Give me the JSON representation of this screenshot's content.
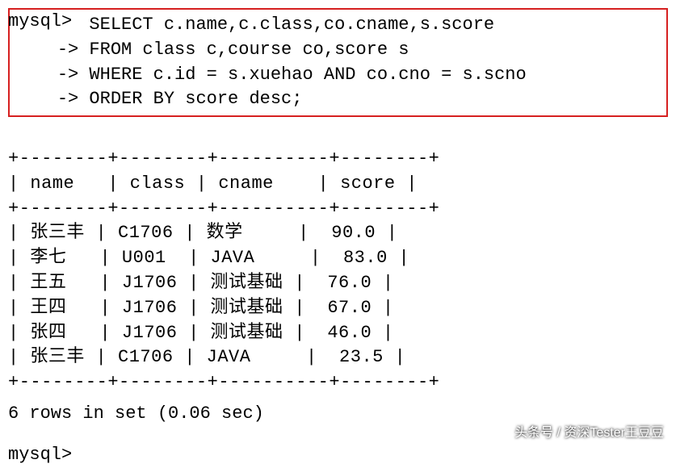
{
  "prompt": "mysql>",
  "continuation": "-> ",
  "query": {
    "line1": "SELECT c.name,c.class,co.cname,s.score",
    "line2": "FROM class c,course co,score s",
    "line3": "WHERE c.id = s.xuehao AND co.cno = s.scno",
    "line4": "ORDER BY score desc;"
  },
  "table": {
    "border_top": "+--------+--------+----------+--------+",
    "header": "| name   | class | cname    | score |",
    "border_mid": "+--------+--------+----------+--------+",
    "rows": [
      "| 张三丰 | C1706 | 数学     |  90.0 |",
      "| 李七   | U001  | JAVA     |  83.0 |",
      "| 王五   | J1706 | 测试基础 |  76.0 |",
      "| 王四   | J1706 | 测试基础 |  67.0 |",
      "| 张四   | J1706 | 测试基础 |  46.0 |",
      "| 张三丰 | C1706 | JAVA     |  23.5 |"
    ],
    "border_bot": "+--------+--------+----------+--------+"
  },
  "chart_data": {
    "type": "table",
    "columns": [
      "name",
      "class",
      "cname",
      "score"
    ],
    "rows": [
      {
        "name": "张三丰",
        "class": "C1706",
        "cname": "数学",
        "score": 90.0
      },
      {
        "name": "李七",
        "class": "U001",
        "cname": "JAVA",
        "score": 83.0
      },
      {
        "name": "王五",
        "class": "J1706",
        "cname": "测试基础",
        "score": 76.0
      },
      {
        "name": "王四",
        "class": "J1706",
        "cname": "测试基础",
        "score": 67.0
      },
      {
        "name": "张四",
        "class": "J1706",
        "cname": "测试基础",
        "score": 46.0
      },
      {
        "name": "张三丰",
        "class": "C1706",
        "cname": "JAVA",
        "score": 23.5
      }
    ]
  },
  "result_summary": "6 rows in set (0.06 sec)",
  "bottom_prompt": "mysql>",
  "watermark": "头条号 / 资深Tester王豆豆"
}
